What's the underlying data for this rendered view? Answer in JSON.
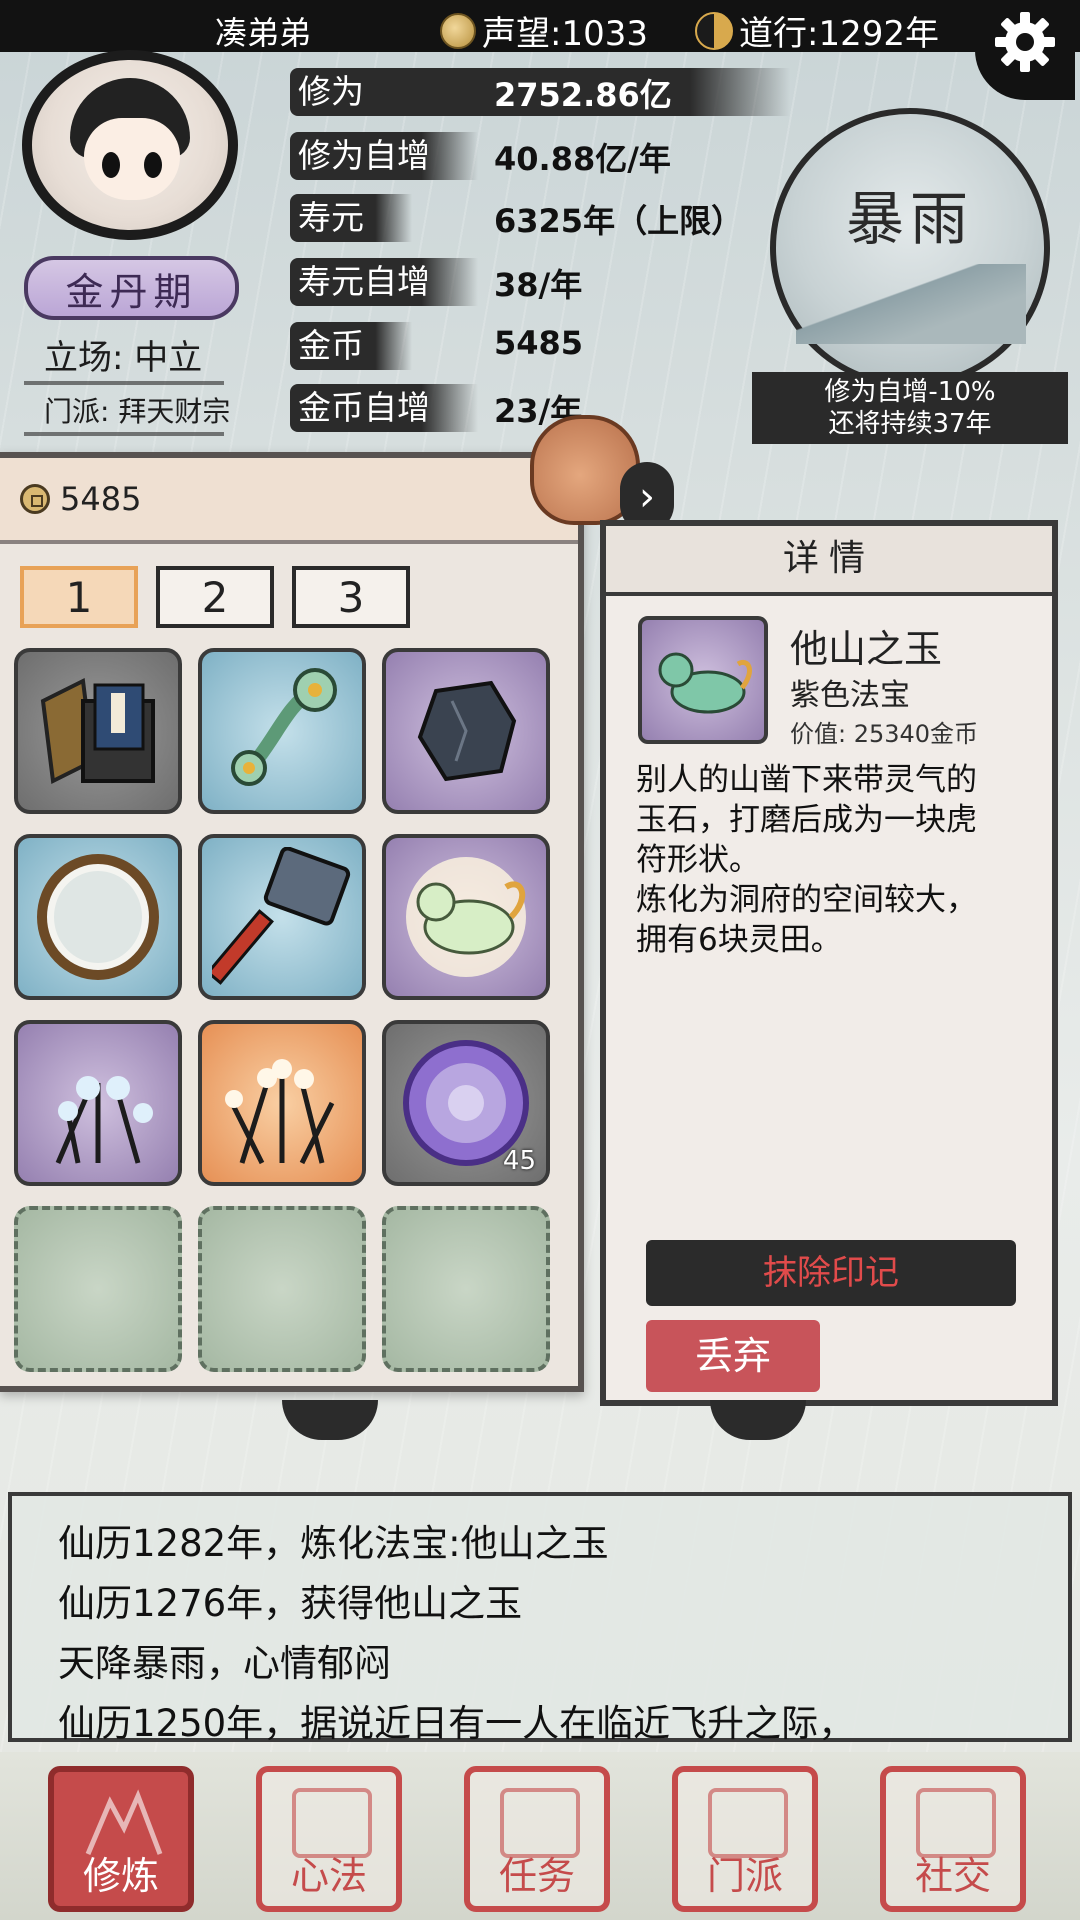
{
  "topbar": {
    "player_name": "凑弟弟",
    "fame": "声望:1033",
    "dao_years": "道行:1292年"
  },
  "profile": {
    "rank": "金丹期",
    "stance": "立场: 中立",
    "sect": "门派: 拜天财宗"
  },
  "stats": [
    {
      "label": "修为",
      "value": "2752.86亿"
    },
    {
      "label": "修为自增",
      "value": "40.88亿/年"
    },
    {
      "label": "寿元",
      "value": "6325年（上限）"
    },
    {
      "label": "寿元自增",
      "value": "38/年"
    },
    {
      "label": "金币",
      "value": "5485"
    },
    {
      "label": "金币自增",
      "value": "23/年"
    }
  ],
  "weather": {
    "title": "暴雨",
    "effect_line1": "修为自增-10%",
    "effect_line2": "还将持续37年"
  },
  "inventory": {
    "coins": "5485",
    "tabs": [
      "1",
      "2",
      "3"
    ],
    "active_tab": 0,
    "slots": [
      {
        "item": "book-box-icon",
        "tier": "gray"
      },
      {
        "item": "jade-ruyi-icon",
        "tier": "blue"
      },
      {
        "item": "dark-stone-icon",
        "tier": "purple"
      },
      {
        "item": "mirror-icon",
        "tier": "blue"
      },
      {
        "item": "hammer-icon",
        "tier": "blue"
      },
      {
        "item": "glowing-beast-icon",
        "tier": "purple"
      },
      {
        "item": "blue-flower-herb-icon",
        "tier": "purple"
      },
      {
        "item": "white-flower-herb-icon",
        "tier": "orange"
      },
      {
        "item": "vortex-orb-icon",
        "tier": "gray",
        "count": "45"
      },
      {
        "item": "empty",
        "tier": "empty"
      },
      {
        "item": "empty",
        "tier": "empty"
      },
      {
        "item": "empty",
        "tier": "empty"
      }
    ]
  },
  "detail": {
    "header": "详情",
    "name": "他山之玉",
    "grade": "紫色法宝",
    "value": "价值: 25340金币",
    "description": "别人的山凿下来带灵气的\n玉石，打磨后成为一块虎\n符形状。\n炼化为洞府的空间较大，\n拥有6块灵田。",
    "erase_label": "抹除印记",
    "discard_label": "丢弃"
  },
  "log": [
    "仙历1282年，炼化法宝:他山之玉",
    "仙历1276年，获得他山之玉",
    "天降暴雨，心情郁闷",
    "仙历1250年，据说近日有一人在临近飞升之际，"
  ],
  "nav": [
    {
      "label": "修炼",
      "active": true
    },
    {
      "label": "心法",
      "active": false
    },
    {
      "label": "任务",
      "active": false
    },
    {
      "label": "门派",
      "active": false
    },
    {
      "label": "社交",
      "active": false
    }
  ],
  "colors": {
    "accent_red": "#c54b4b",
    "topbar_bg": "#121212",
    "panel_border": "#3a3a3a"
  }
}
